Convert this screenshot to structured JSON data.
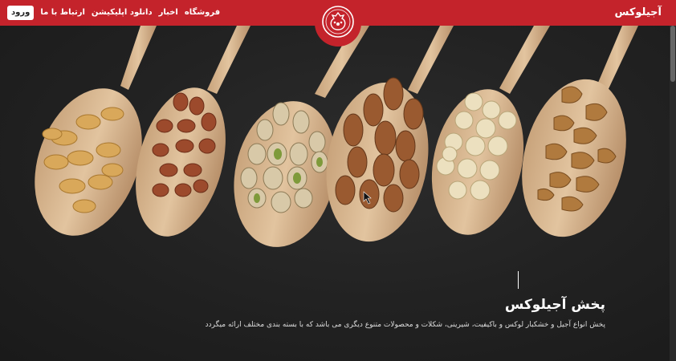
{
  "header": {
    "brand": "آجیلوکس",
    "nav": {
      "login": "ورود",
      "contact": "ارتباط با ما",
      "download": "دانلود اپلیکیشن",
      "news": "اخبار",
      "shop": "فروشگاه"
    }
  },
  "hero": {
    "title": "پخش آجیلوکس",
    "subtitle": "پخش انواع آجیل و خشکبار لوکس و باکیفیت، شیرینی، شکلات و محصولات متنوع دیگری می باشد که با بسته بندی مختلف ارائه میگردد",
    "image": "nuts-on-wooden-spoons"
  },
  "colors": {
    "header_bg": "#c4232b",
    "hero_bg": "#222222",
    "text": "#ffffff"
  },
  "icons": {
    "logo": "pomegranate-logo-icon"
  }
}
